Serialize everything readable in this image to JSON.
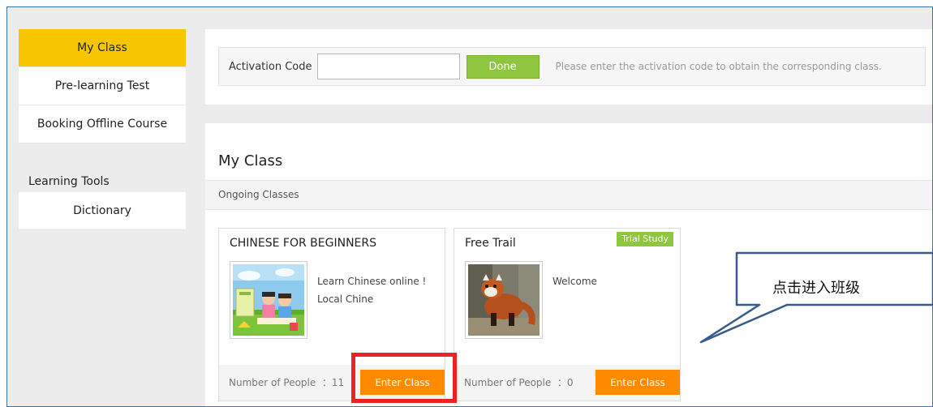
{
  "sidebar": {
    "items": [
      {
        "label": "My Class",
        "active": true
      },
      {
        "label": "Pre-learning Test",
        "active": false
      },
      {
        "label": "Booking Offline Course",
        "active": false
      }
    ],
    "tools_title": "Learning Tools",
    "tools": [
      {
        "label": "Dictionary"
      }
    ]
  },
  "activation": {
    "label": "Activation Code",
    "input_value": "",
    "done_label": "Done",
    "hint": "Please enter the activation code to obtain the corresponding class."
  },
  "my_class": {
    "title": "My Class",
    "section_label": "Ongoing Classes",
    "cards": [
      {
        "title": "CHINESE FOR BEGINNERS",
        "description": "Learn Chinese online ! Local Chine",
        "people": "Number of People  ：11",
        "enter_label": "Enter Class",
        "badge": ""
      },
      {
        "title": "Free Trail",
        "description": "Welcome",
        "people": "Number of People  ：0",
        "enter_label": "Enter Class",
        "badge": "Trial Study"
      }
    ]
  },
  "annotation": {
    "callout_text": "点击进入班级"
  },
  "colors": {
    "active_nav": "#f7c600",
    "done_button": "#8fc63f",
    "enter_button": "#ff8a00",
    "highlight": "#ee2222",
    "callout_border": "#3a5a8a"
  },
  "icons": {
    "card1_image": "children-reading-image",
    "card2_image": "red-panda-image"
  }
}
